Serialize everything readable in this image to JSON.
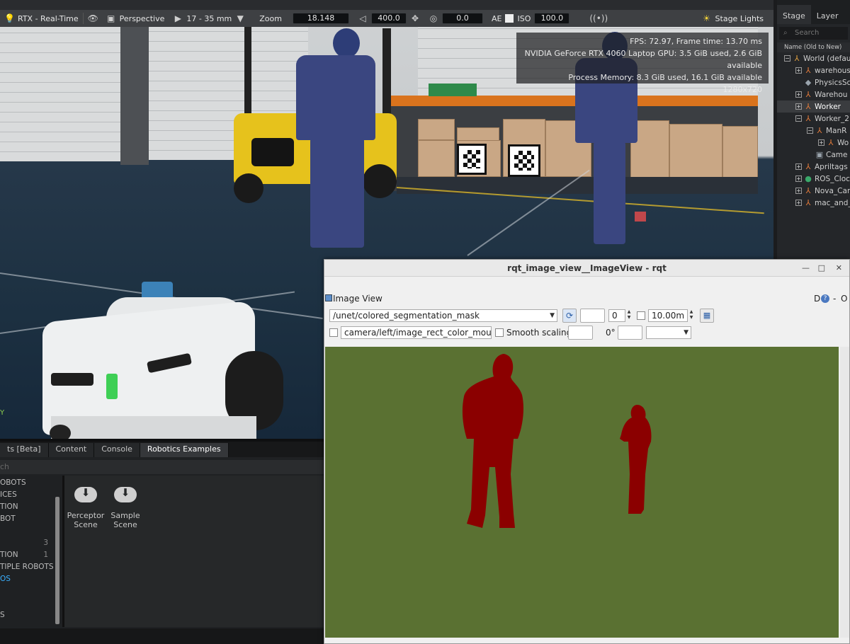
{
  "toolbar": {
    "renderer": "RTX - Real-Time",
    "camera": "Perspective",
    "lens": "17 - 35 mm",
    "zoom_label": "Zoom",
    "zoom_value": "18.148",
    "speed_value": "400.0",
    "exposure_value": "0.0",
    "ae_label": "AE",
    "iso_label": "ISO",
    "iso_value": "100.0",
    "lights_label": "Stage Lights"
  },
  "stats": {
    "fps": "FPS: 72.97, Frame time: 13.70 ms",
    "gpu": "NVIDIA GeForce RTX 4060 Laptop GPU: 3.5 GiB used, 2.6 GiB available",
    "memory": "Process Memory: 8.3 GiB used, 16.1 GiB available",
    "resolution": "1280x720"
  },
  "viewport": {
    "axis_label": "Y"
  },
  "stage": {
    "tabs": [
      "Stage",
      "Layer"
    ],
    "search_placeholder": "Search",
    "column_header": "Name (Old to New)",
    "tree": [
      {
        "toggle": "−",
        "indent": 0,
        "label": "World (defau",
        "icon": "world-icon",
        "color": "#e0a040"
      },
      {
        "toggle": "+",
        "indent": 1,
        "label": "warehous",
        "icon": "xform-icon",
        "color": "#e07a3a"
      },
      {
        "toggle": "",
        "indent": 1,
        "label": "PhysicsSc",
        "icon": "physics-icon",
        "color": "#9aa4ad"
      },
      {
        "toggle": "+",
        "indent": 1,
        "label": "Warehou",
        "icon": "xform-icon",
        "color": "#e07a3a"
      },
      {
        "toggle": "+",
        "indent": 1,
        "label": "Worker",
        "icon": "xform-icon",
        "color": "#e07a3a",
        "selected": true
      },
      {
        "toggle": "−",
        "indent": 1,
        "label": "Worker_2",
        "icon": "xform-icon",
        "color": "#e07a3a"
      },
      {
        "toggle": "−",
        "indent": 2,
        "label": "ManR",
        "icon": "xform-icon",
        "color": "#e07a3a"
      },
      {
        "toggle": "+",
        "indent": 3,
        "label": "Wo",
        "icon": "xform-icon",
        "color": "#e07a3a"
      },
      {
        "toggle": "",
        "indent": 2,
        "label": "Came",
        "icon": "camera-icon",
        "color": "#9aa4ad"
      },
      {
        "toggle": "+",
        "indent": 1,
        "label": "Apriltags",
        "icon": "xform-icon",
        "color": "#e07a3a"
      },
      {
        "toggle": "+",
        "indent": 1,
        "label": "ROS_Clock",
        "icon": "graph-icon",
        "color": "#3aa86a"
      },
      {
        "toggle": "+",
        "indent": 1,
        "label": "Nova_Car",
        "icon": "xform-icon",
        "color": "#e07a3a"
      },
      {
        "toggle": "+",
        "indent": 1,
        "label": "mac_and_",
        "icon": "xform-icon",
        "color": "#e07a3a"
      }
    ]
  },
  "bottom": {
    "tabs": [
      "ts [Beta]",
      "Content",
      "Console",
      "Robotics Examples"
    ],
    "search_placeholder": "ch",
    "list": [
      {
        "label": "OBOTS"
      },
      {
        "label": "ICES"
      },
      {
        "label": "TION"
      },
      {
        "label": "BOT"
      },
      {
        "label": ""
      },
      {
        "label": "",
        "count": "3"
      },
      {
        "label": "TION",
        "count": "1"
      },
      {
        "label": "TIPLE ROBOTS"
      },
      {
        "label": "OS",
        "highlight": true
      },
      {
        "label": ""
      },
      {
        "label": ""
      },
      {
        "label": "S"
      }
    ],
    "scenes": [
      {
        "line1": "Perceptor",
        "line2": "Scene"
      },
      {
        "line1": "Sample",
        "line2": "Scene"
      }
    ]
  },
  "rqt": {
    "title": "rqt_image_view__ImageView - rqt",
    "plugin_title": "Image View",
    "plugin_controls": "D",
    "plugin_close": "O",
    "topic": "/unet/colored_segmentation_mask",
    "spin_value": "0",
    "max_range": "10.00m",
    "mouse_topic": "camera/left/image_rect_color_mouse_left",
    "smooth_label": "Smooth scaling",
    "rotation": "0°",
    "colors": {
      "background": "#5a7132",
      "person": "#8b0000"
    }
  }
}
